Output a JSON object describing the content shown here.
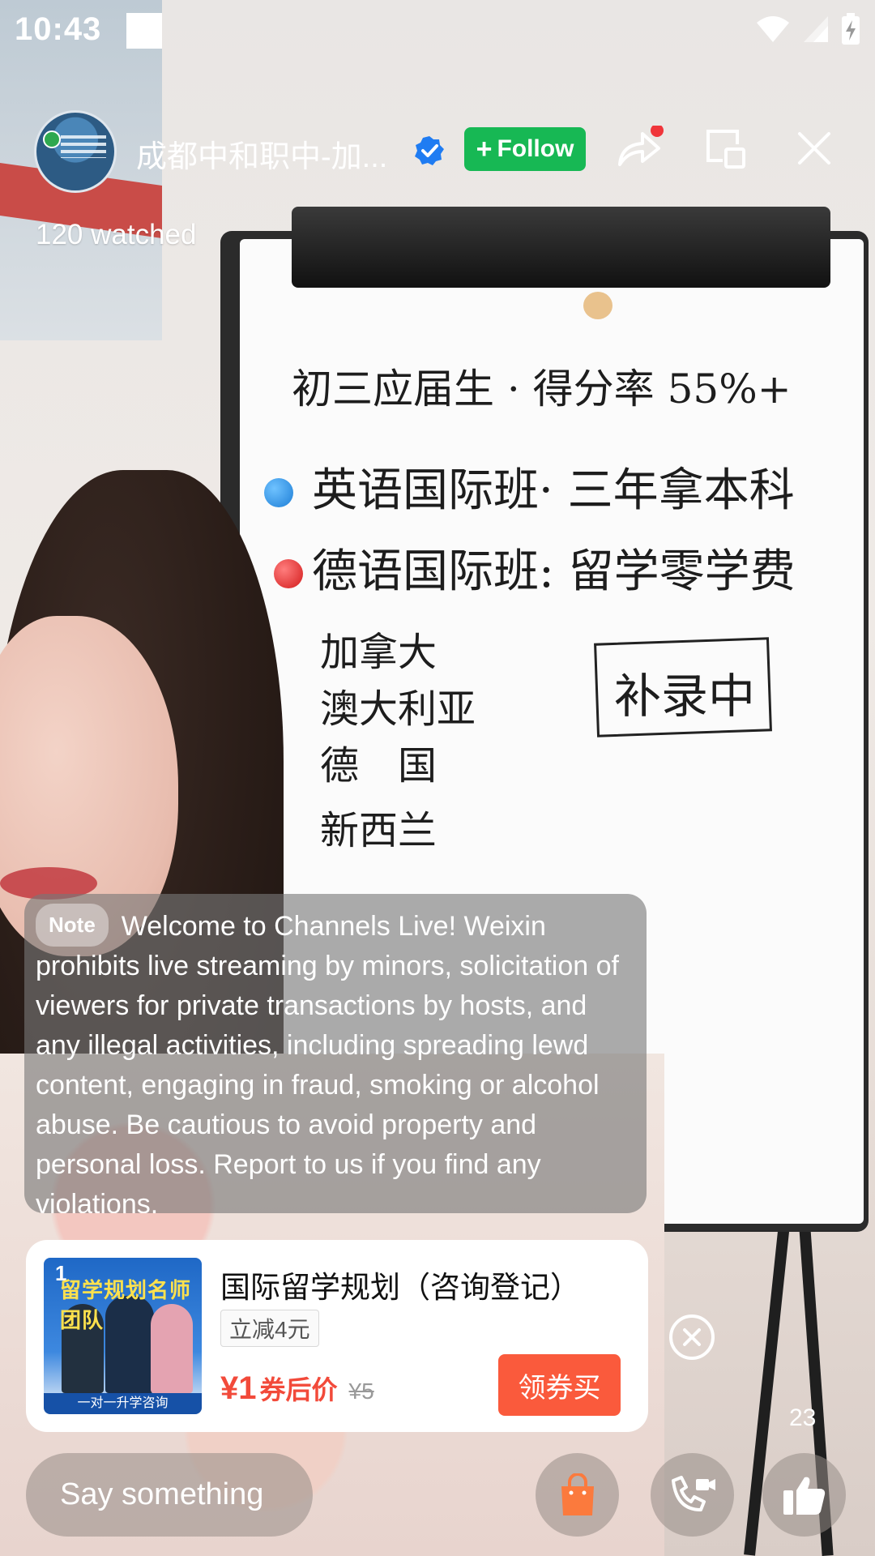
{
  "status_bar": {
    "time": "10:43"
  },
  "header": {
    "channel_name": "成都中和职中-加...",
    "follow_label": "Follow",
    "watched": "120 watched"
  },
  "whiteboard": {
    "line1": "初三应届生 · 得分率 55%+",
    "line2": "英语国际班· 三年拿本科",
    "line3": "德语国际班: 留学零学费",
    "countries": [
      "加拿大",
      "澳大利亚",
      "德　国",
      "新西兰"
    ],
    "boxed": "补录中"
  },
  "notice": {
    "tag": "Note",
    "text": "Welcome to Channels Live! Weixin prohibits live streaming by minors, solicitation of viewers for private transactions by hosts, and any illegal activities, including spreading lewd content, engaging in fraud, smoking or alcohol abuse. Be cautious to avoid property and personal loss. Report to us if you find any violations."
  },
  "product": {
    "index": "1",
    "thumb_title": "留学规划名师团队",
    "thumb_subtitle": "一对一升学咨询",
    "title": "国际留学规划（咨询登记）",
    "coupon": "立减4元",
    "price": "¥1",
    "price_suffix": "券后价",
    "original_price": "¥5",
    "buy_label": "领券买"
  },
  "likes": "23",
  "bottom": {
    "placeholder": "Say something"
  },
  "colors": {
    "follow": "#17b854",
    "buy": "#fa5a3c",
    "price": "#f24a3a",
    "shop_bag": "#fb7a3d"
  }
}
